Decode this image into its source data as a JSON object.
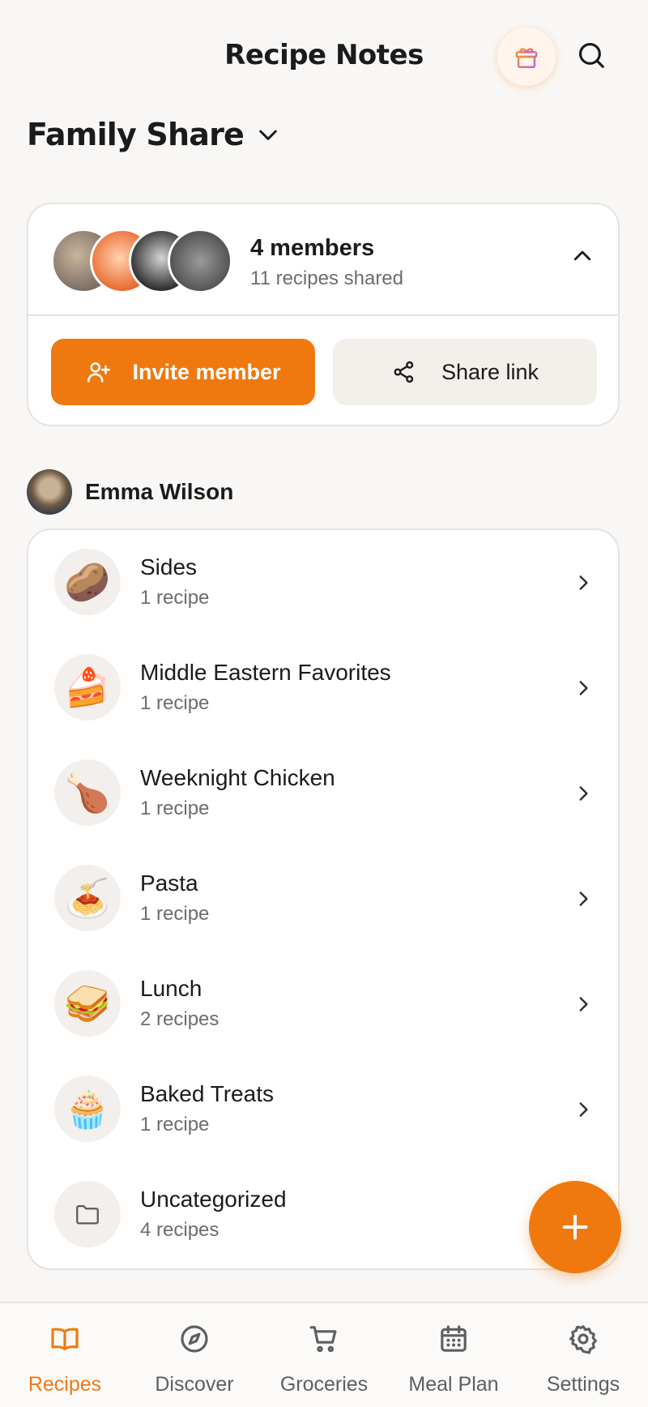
{
  "header": {
    "title": "Recipe Notes",
    "gift_icon": "gift-icon",
    "search_icon": "search-icon"
  },
  "group": {
    "name": "Family Share"
  },
  "members_card": {
    "members_count": "4 members",
    "recipes_shared": "11 recipes shared",
    "invite_label": "Invite member",
    "share_label": "Share link"
  },
  "owner": {
    "name": "Emma Wilson"
  },
  "collections": [
    {
      "title": "Sides",
      "count": "1 recipe",
      "icon": "🥔"
    },
    {
      "title": "Middle Eastern Favorites",
      "count": "1 recipe",
      "icon": "🍰"
    },
    {
      "title": "Weeknight Chicken",
      "count": "1 recipe",
      "icon": "🍗"
    },
    {
      "title": "Pasta",
      "count": "1 recipe",
      "icon": "🍝"
    },
    {
      "title": "Lunch",
      "count": "2 recipes",
      "icon": "🥪"
    },
    {
      "title": "Baked Treats",
      "count": "1 recipe",
      "icon": "🧁"
    },
    {
      "title": "Uncategorized",
      "count": "4 recipes",
      "icon": "folder-icon"
    }
  ],
  "tabs": [
    {
      "label": "Recipes",
      "icon": "book-icon",
      "active": true
    },
    {
      "label": "Discover",
      "icon": "compass-icon",
      "active": false
    },
    {
      "label": "Groceries",
      "icon": "cart-icon",
      "active": false
    },
    {
      "label": "Meal Plan",
      "icon": "calendar-icon",
      "active": false
    },
    {
      "label": "Settings",
      "icon": "gear-icon",
      "active": false
    }
  ],
  "colors": {
    "accent": "#f0790f",
    "background": "#f9f7f5",
    "muted_text": "#6d6d6d"
  }
}
